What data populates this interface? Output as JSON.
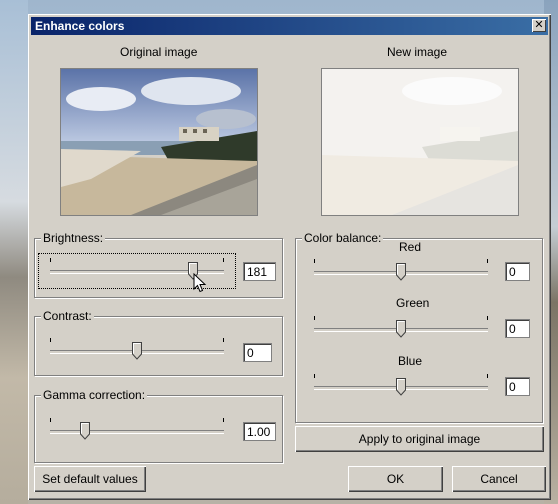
{
  "window": {
    "title": "Enhance colors",
    "close_glyph": "✕"
  },
  "images": {
    "original_label": "Original image",
    "new_label": "New image"
  },
  "brightness": {
    "label": "Brightness:",
    "value": "181",
    "level_fraction": 0.84
  },
  "contrast": {
    "label": "Contrast:",
    "value": "0",
    "level_fraction": 0.5
  },
  "gamma": {
    "label": "Gamma correction:",
    "value": "1.00",
    "level_fraction": 0.18
  },
  "color_balance": {
    "label": "Color balance:",
    "red": {
      "label": "Red",
      "value": "0",
      "level_fraction": 0.5
    },
    "green": {
      "label": "Green",
      "value": "0",
      "level_fraction": 0.5
    },
    "blue": {
      "label": "Blue",
      "value": "0",
      "level_fraction": 0.5
    }
  },
  "buttons": {
    "apply": "Apply to original image",
    "defaults": "Set default values",
    "ok": "OK",
    "cancel": "Cancel"
  },
  "colors": {
    "titlebar_start": "#0a246a",
    "titlebar_end": "#3a6ea5",
    "face": "#d4d0c8"
  }
}
